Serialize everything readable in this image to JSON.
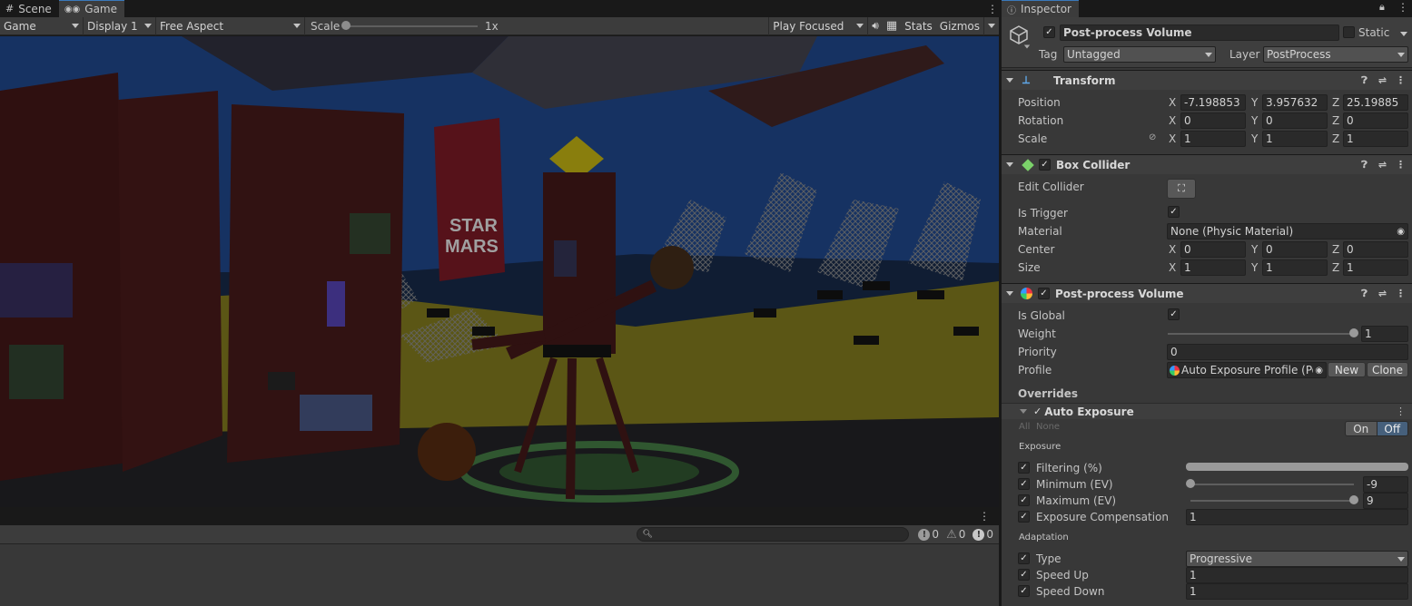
{
  "tabs": {
    "scene": "Scene",
    "game": "Game",
    "inspector": "Inspector"
  },
  "game_toolbar": {
    "display_mode": "Game",
    "display": "Display 1",
    "aspect": "Free Aspect",
    "scale_label": "Scale",
    "scale_value": "1x",
    "scale_fraction": 0.0,
    "play_mode": "Play Focused",
    "stats": "Stats",
    "gizmos": "Gizmos"
  },
  "scene_art": {
    "poster_line1": "STAR",
    "poster_line2": "MARS"
  },
  "console": {
    "errors": "0",
    "warnings": "0",
    "messages": "0"
  },
  "object": {
    "name": "Post-process Volume",
    "static_label": "Static",
    "tag_label": "Tag",
    "tag": "Untagged",
    "layer_label": "Layer",
    "layer": "PostProcess"
  },
  "transform": {
    "title": "Transform",
    "position_label": "Position",
    "rotation_label": "Rotation",
    "scale_label": "Scale",
    "position": {
      "x": "-7.198853",
      "y": "3.957632",
      "z": "25.19885"
    },
    "rotation": {
      "x": "0",
      "y": "0",
      "z": "0"
    },
    "scale": {
      "x": "1",
      "y": "1",
      "z": "1"
    }
  },
  "axis": {
    "x": "X",
    "y": "Y",
    "z": "Z"
  },
  "box_collider": {
    "title": "Box Collider",
    "edit_label": "Edit Collider",
    "is_trigger_label": "Is Trigger",
    "material_label": "Material",
    "material": "None (Physic Material)",
    "center_label": "Center",
    "size_label": "Size",
    "center": {
      "x": "0",
      "y": "0",
      "z": "0"
    },
    "size": {
      "x": "1",
      "y": "1",
      "z": "1"
    }
  },
  "ppv": {
    "title": "Post-process Volume",
    "is_global_label": "Is Global",
    "weight_label": "Weight",
    "weight": "1",
    "weight_fraction": 1.0,
    "priority_label": "Priority",
    "priority": "0",
    "profile_label": "Profile",
    "profile": "Auto Exposure Profile (Po",
    "new_btn": "New",
    "clone_btn": "Clone",
    "overrides": "Overrides"
  },
  "auto_exposure": {
    "title": "Auto Exposure",
    "all": "All",
    "none": "None",
    "on": "On",
    "off": "Off",
    "exposure_section": "Exposure",
    "filtering_label": "Filtering (%)",
    "minimum_label": "Minimum (EV)",
    "minimum": "-9",
    "minimum_fraction": 0.0,
    "maximum_label": "Maximum (EV)",
    "maximum": "9",
    "maximum_fraction": 1.0,
    "compensation_label": "Exposure Compensation",
    "compensation": "1",
    "adaptation_section": "Adaptation",
    "type_label": "Type",
    "type": "Progressive",
    "speed_up_label": "Speed Up",
    "speed_up": "1",
    "speed_down_label": "Speed Down",
    "speed_down": "1"
  },
  "colors": {
    "accent": "#3a79bb",
    "panel": "#383838",
    "header": "#3e3e3e",
    "field": "#2a2a2a",
    "off_selected": "#46607c"
  }
}
